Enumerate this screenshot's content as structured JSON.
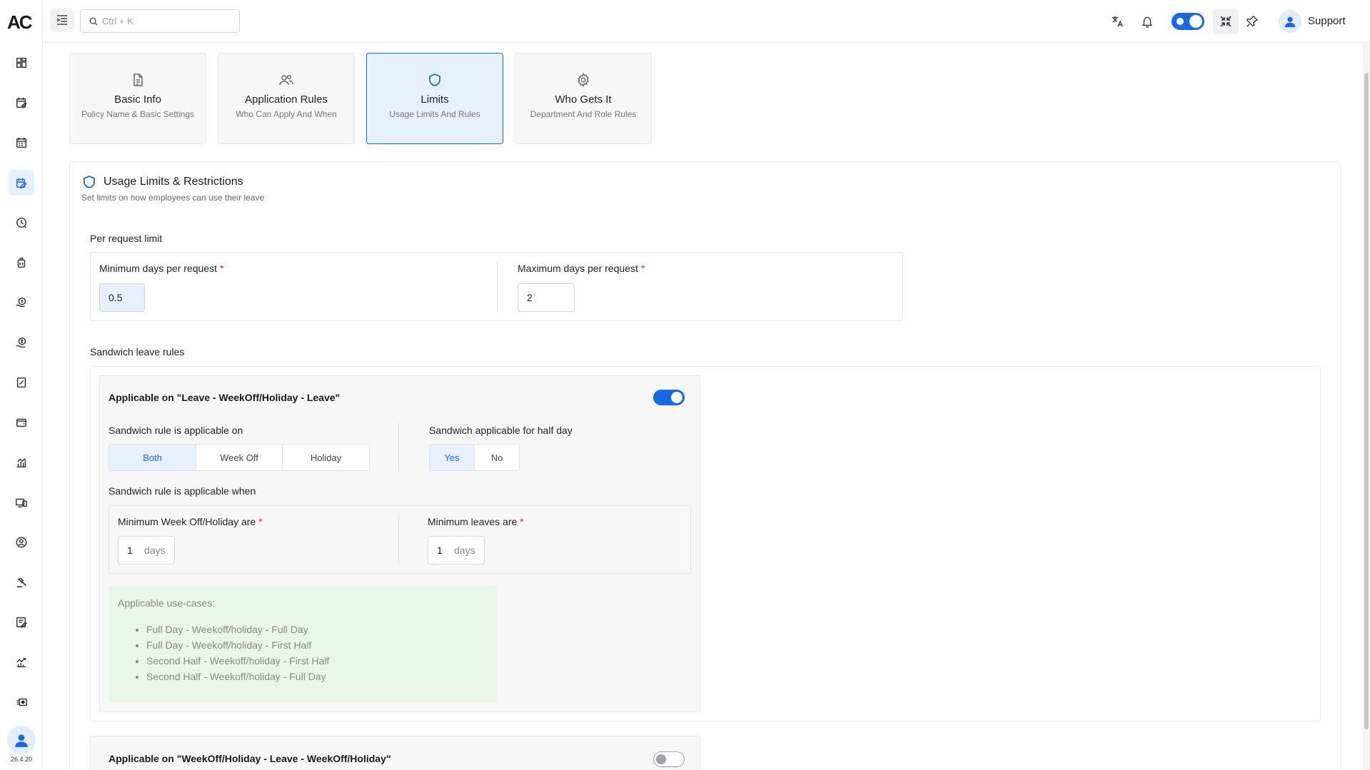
{
  "sidebar": {
    "logo": "AC",
    "version": "26.4.20",
    "icons": [
      "dashboard-icon",
      "attendance-icon",
      "calendar-icon",
      "leave-icon",
      "time-tracking-icon",
      "luggage-icon",
      "payroll-icon",
      "expense-icon",
      "tax-icon",
      "wallet-icon",
      "reports-icon",
      "devices-icon",
      "profile-icon",
      "legal-icon",
      "tasks-icon",
      "analytics-icon",
      "assets-icon"
    ]
  },
  "topbar": {
    "search_placeholder": "Ctrl + K",
    "support_label": "Support"
  },
  "steps": [
    {
      "title": "Basic Info",
      "subtitle": "Policy Name & Basic Settings",
      "icon": "document-icon"
    },
    {
      "title": "Application Rules",
      "subtitle": "Who Can Apply And When",
      "icon": "users-icon"
    },
    {
      "title": "Limits",
      "subtitle": "Usage Limits And Rules",
      "icon": "shield-icon"
    },
    {
      "title": "Who Gets It",
      "subtitle": "Department And Role Rules",
      "icon": "gear-icon"
    }
  ],
  "section": {
    "title": "Usage Limits & Restrictions",
    "subtitle": "Set limits on how employees can use their leave"
  },
  "per_request": {
    "heading": "Per request limit",
    "min_label": "Minimum days per request",
    "min_value": "0.5",
    "max_label": "Maximum days per request",
    "max_value": "2",
    "required_mark": "*"
  },
  "sandwich": {
    "heading": "Sandwich leave rules",
    "rule1": {
      "title": "Applicable on \"Leave - WeekOff/Holiday - Leave\"",
      "enabled": true,
      "applicable_on_label": "Sandwich rule is applicable on",
      "applicable_on_options": [
        "Both",
        "Week Off",
        "Holiday"
      ],
      "applicable_on_selected": "Both",
      "half_day_label": "Sandwich applicable for half day",
      "half_day_options": [
        "Yes",
        "No"
      ],
      "half_day_selected": "Yes",
      "when_label": "Sandwich rule is applicable when",
      "min_weekoff_label": "Minimum Week Off/Holiday are",
      "min_weekoff_value": "1",
      "min_leaves_label": "Minimum leaves are",
      "min_leaves_value": "1",
      "unit": "days",
      "usecases_title": "Applicable use-cases:",
      "usecases": [
        "Full Day - Weekoff/holiday - Full Day",
        "Full Day - Weekoff/holiday - First Half",
        "Second Half - Weekoff/holiday - First Half",
        "Second Half - Weekoff/holiday - Full Day"
      ]
    },
    "rule2": {
      "title": "Applicable on \"WeekOff/Holiday - Leave - WeekOff/Holiday\"",
      "enabled": false
    }
  }
}
